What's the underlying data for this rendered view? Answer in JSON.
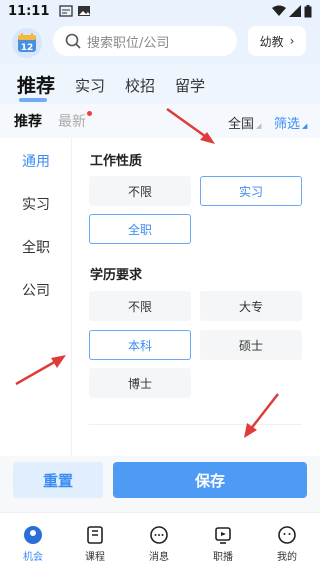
{
  "status_bar": {
    "time": "11:11"
  },
  "header": {
    "calendar_day": "12",
    "search_placeholder": "搜索职位/公司",
    "city_label": "幼教"
  },
  "main_tabs": [
    {
      "label": "推荐"
    },
    {
      "label": "实习"
    },
    {
      "label": "校招"
    },
    {
      "label": "留学"
    }
  ],
  "sub_tabs": {
    "recommended": "推荐",
    "latest": "最新",
    "region": "全国",
    "filter": "筛选"
  },
  "side_menu": [
    {
      "label": "通用"
    },
    {
      "label": "实习"
    },
    {
      "label": "全职"
    },
    {
      "label": "公司"
    }
  ],
  "sections": {
    "work_type": {
      "title": "工作性质",
      "options": [
        "不限",
        "实习",
        "全职"
      ]
    },
    "education": {
      "title": "学历要求",
      "options": [
        "不限",
        "大专",
        "本科",
        "硕士",
        "博士"
      ]
    }
  },
  "footer": {
    "reset_label": "重置",
    "save_label": "保存"
  },
  "bottom_nav": [
    {
      "label": "机会"
    },
    {
      "label": "课程"
    },
    {
      "label": "消息"
    },
    {
      "label": "职播"
    },
    {
      "label": "我的"
    }
  ],
  "colors": {
    "accent": "#3b8cf3",
    "arrow": "#e03b3b"
  }
}
